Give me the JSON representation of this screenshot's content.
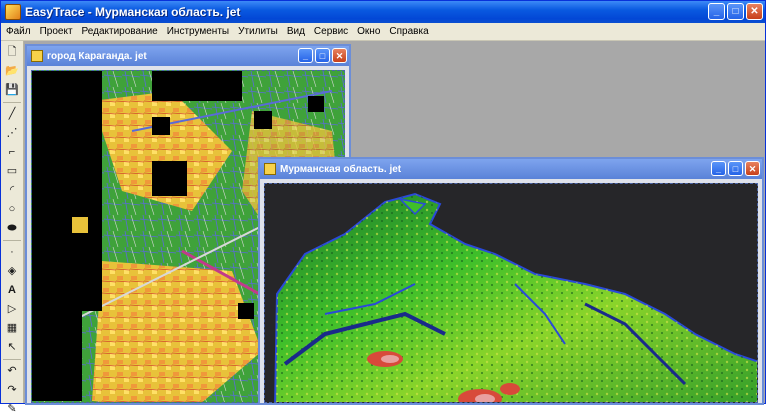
{
  "app": {
    "title": "EasyTrace - Мурманская область. jet"
  },
  "menu": [
    "Файл",
    "Проект",
    "Редактирование",
    "Инструменты",
    "Утилиты",
    "Вид",
    "Сервис",
    "Окно",
    "Справка"
  ],
  "windows": [
    {
      "title": "город Караганда. jet"
    },
    {
      "title": "Мурманская область. jet"
    }
  ],
  "tools": [
    "new-icon",
    "open-icon",
    "save-icon",
    "line-icon",
    "polyline-icon",
    "step-icon",
    "rect-icon",
    "arc-icon",
    "circle-icon",
    "ellipse-icon",
    "point-icon",
    "fill-icon",
    "text-icon",
    "select-icon",
    "node-icon",
    "pointer-icon",
    "undo-icon",
    "redo-icon",
    "pen-icon"
  ],
  "colors": {
    "titlebar": "#0a5ae0",
    "map_green": "#3fa23a",
    "map_yellow": "#e8c23a",
    "relief_green": "#2fb52a",
    "background": "#a8a8a8"
  }
}
